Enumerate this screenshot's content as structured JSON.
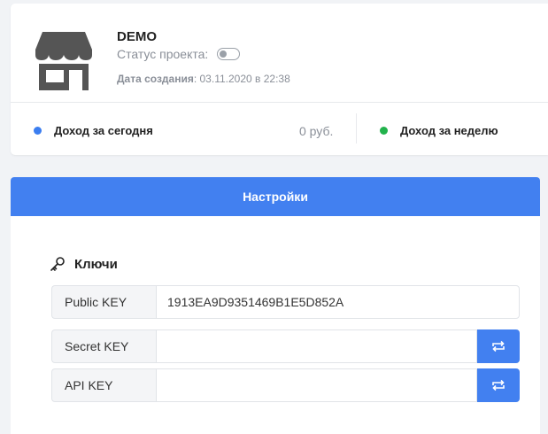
{
  "project": {
    "name": "DEMO",
    "status_label": "Статус проекта:",
    "status_enabled": false,
    "created_label": "Дата создания",
    "created_value": ": 03.11.2020 в 22:38"
  },
  "income": [
    {
      "label": "Доход за сегодня",
      "value": "0 руб.",
      "dot_color": "#3b7ef0"
    },
    {
      "label": "Доход за неделю",
      "dot_color": "#22b24c"
    }
  ],
  "tabs": {
    "settings": "Настройки"
  },
  "keys": {
    "title": "Ключи",
    "public": {
      "label": "Public KEY",
      "value": "1913EA9D9351469B1E5D852A"
    },
    "secret": {
      "label": "Secret KEY",
      "value": ""
    },
    "api": {
      "label": "API KEY",
      "value": ""
    }
  },
  "icons": {
    "store": "store-icon",
    "key": "key-icon",
    "regenerate": "refresh-arrows-icon"
  },
  "colors": {
    "accent": "#4280f0",
    "store_icon": "#555555"
  }
}
